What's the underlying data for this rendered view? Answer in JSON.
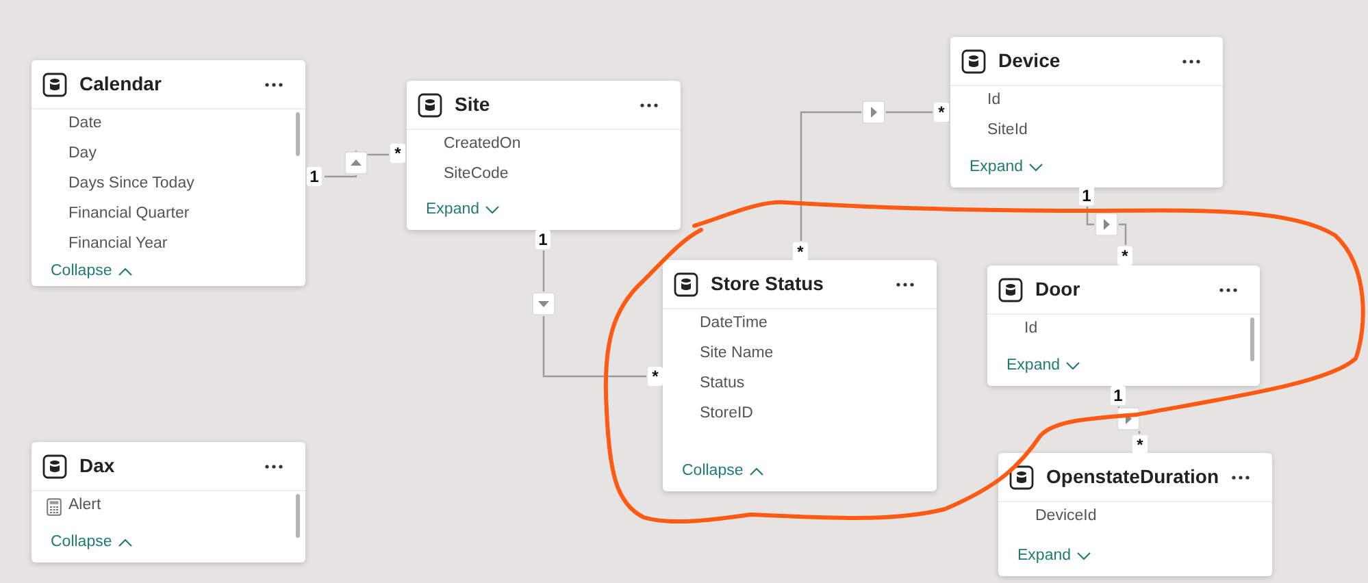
{
  "tables": [
    {
      "name": "Calendar",
      "scrollable": true,
      "fields": [
        {
          "label": "Date",
          "kind": "column"
        },
        {
          "label": "Day",
          "kind": "column"
        },
        {
          "label": "Days Since Today",
          "kind": "column"
        },
        {
          "label": "Financial Quarter",
          "kind": "column"
        },
        {
          "label": "Financial Year",
          "kind": "column"
        }
      ],
      "footer": {
        "label": "Collapse",
        "expanded": true
      }
    },
    {
      "name": "Site",
      "scrollable": false,
      "fields": [
        {
          "label": "CreatedOn",
          "kind": "column"
        },
        {
          "label": "SiteCode",
          "kind": "column"
        }
      ],
      "footer": {
        "label": "Expand",
        "expanded": false
      }
    },
    {
      "name": "Device",
      "scrollable": false,
      "fields": [
        {
          "label": "Id",
          "kind": "column"
        },
        {
          "label": "SiteId",
          "kind": "column"
        }
      ],
      "footer": {
        "label": "Expand",
        "expanded": false
      }
    },
    {
      "name": "Store Status",
      "scrollable": false,
      "fields": [
        {
          "label": "DateTime",
          "kind": "column"
        },
        {
          "label": "Site Name",
          "kind": "column"
        },
        {
          "label": "Status",
          "kind": "column"
        },
        {
          "label": "StoreID",
          "kind": "column"
        }
      ],
      "footer": {
        "label": "Collapse",
        "expanded": true
      }
    },
    {
      "name": "Door",
      "scrollable": true,
      "fields": [
        {
          "label": "Id",
          "kind": "column"
        }
      ],
      "footer": {
        "label": "Expand",
        "expanded": false
      }
    },
    {
      "name": "OpenstateDuration",
      "scrollable": false,
      "fields": [
        {
          "label": "DeviceId",
          "kind": "column"
        }
      ],
      "footer": {
        "label": "Expand",
        "expanded": false
      }
    },
    {
      "name": "Dax",
      "scrollable": true,
      "fields": [
        {
          "label": "Alert",
          "kind": "measure"
        }
      ],
      "footer": {
        "label": "Collapse",
        "expanded": true
      }
    }
  ],
  "relationships": [
    {
      "from_label": "1",
      "to_label": "*"
    },
    {
      "from_label": "1",
      "to_label": "*"
    },
    {
      "from_label": "*",
      "to_label": "*"
    },
    {
      "from_label": "1",
      "to_label": "*"
    },
    {
      "from_label": "1",
      "to_label": "*"
    }
  ]
}
